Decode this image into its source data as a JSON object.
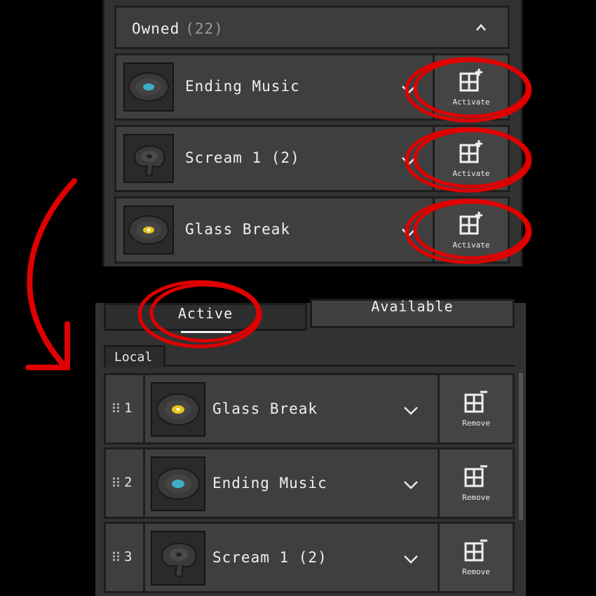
{
  "owned": {
    "title": "Owned",
    "count": "(22)",
    "items": [
      {
        "name": "Ending Music",
        "action": "Activate",
        "disc": "ending-music-disc",
        "center_color": "#3ab0c8"
      },
      {
        "name": "Scream 1 (2)",
        "action": "Activate",
        "disc": "scream-disc",
        "center_color": "#555555"
      },
      {
        "name": "Glass Break",
        "action": "Activate",
        "disc": "glass-break-disc",
        "center_color": "#e6c619"
      }
    ]
  },
  "tabs": {
    "active": "Active",
    "available": "Available"
  },
  "local": {
    "label": "Local",
    "items": [
      {
        "index": "1",
        "name": "Glass Break",
        "action": "Remove",
        "disc": "glass-break-disc",
        "center_color": "#e6c619"
      },
      {
        "index": "2",
        "name": "Ending Music",
        "action": "Remove",
        "disc": "ending-music-disc",
        "center_color": "#3ab0c8"
      },
      {
        "index": "3",
        "name": "Scream 1 (2)",
        "action": "Remove",
        "disc": "scream-disc",
        "center_color": "#555555"
      }
    ]
  },
  "colors": {
    "annotation": "#e00000",
    "background": "#000000",
    "panel": "#323232",
    "row": "#3f3f3f"
  },
  "icons": {
    "collapse": "chevron-up-icon",
    "expand": "chevron-down-icon",
    "activate": "add-pack-icon",
    "remove": "remove-pack-icon",
    "drag": "drag-handle-icon"
  }
}
